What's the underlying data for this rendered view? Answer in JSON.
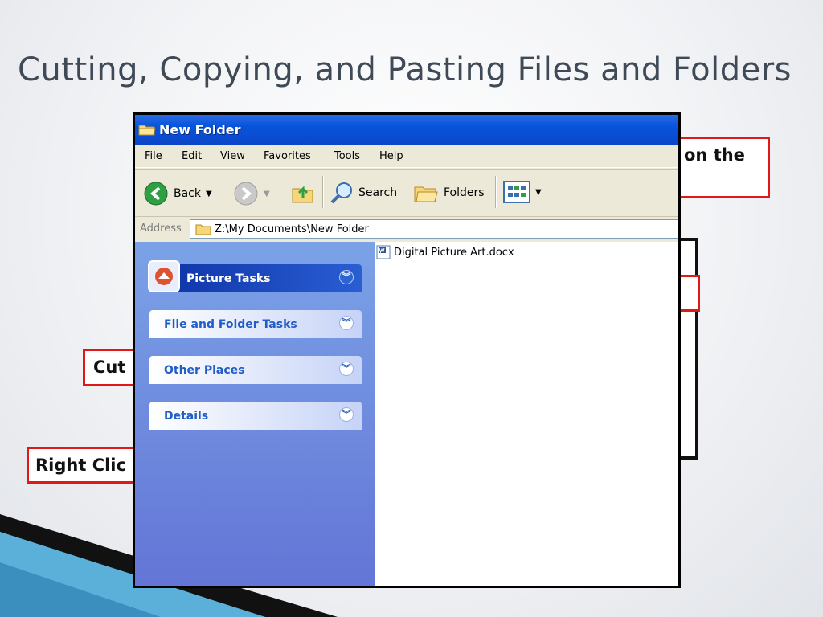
{
  "slide": {
    "title": "Cutting, Copying, and Pasting Files and Folders",
    "callouts": {
      "top_right": "on the",
      "cut": "Cut",
      "right_click": "Right Clic"
    }
  },
  "window": {
    "title": "New Folder",
    "menu": [
      "File",
      "Edit",
      "View",
      "Favorites",
      "Tools",
      "Help"
    ],
    "toolbar": {
      "back": "Back",
      "search": "Search",
      "folders": "Folders"
    },
    "address": {
      "label": "Address",
      "path": "Z:\\My Documents\\New Folder"
    },
    "task_pane": {
      "sections": [
        "Picture Tasks",
        "File and Folder Tasks",
        "Other Places",
        "Details"
      ]
    },
    "files": [
      "Digital Picture Art.docx"
    ]
  },
  "colors": {
    "title_bar": "#0a46c8",
    "task_pane": "#6375d6",
    "callout_border": "#e01818"
  }
}
